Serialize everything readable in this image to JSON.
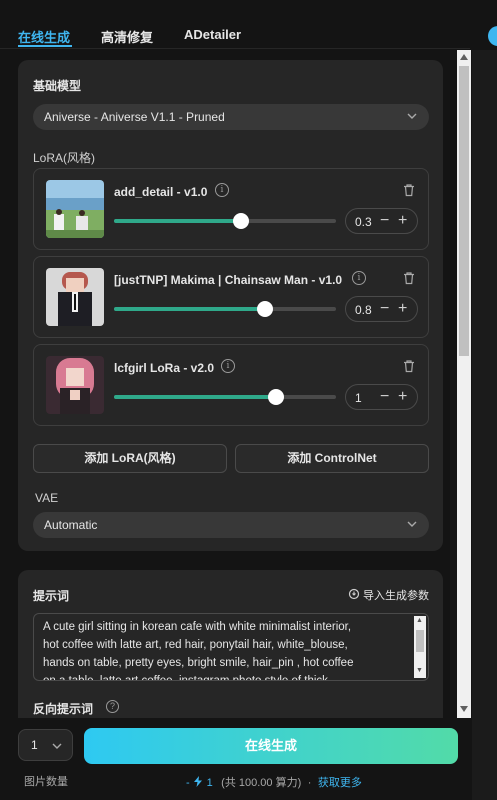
{
  "tabs": [
    "在线生成",
    "高清修复",
    "ADetailer"
  ],
  "base_model": {
    "title": "基础模型",
    "selected": "Aniverse - Aniverse V1.1 - Pruned"
  },
  "lora": {
    "title": "LoRA(风格)",
    "items": [
      {
        "name": "add_detail - v1.0",
        "value": "0.3",
        "slider_fraction": 0.57
      },
      {
        "name": "[justTNP] Makima | Chainsaw Man - v1.0",
        "value": "0.8",
        "slider_fraction": 0.68
      },
      {
        "name": "lcfgirl LoRa - v2.0",
        "value": "1",
        "slider_fraction": 0.73
      }
    ],
    "minus": "−",
    "plus": "+"
  },
  "buttons": {
    "add_lora": "添加 LoRA(风格)",
    "add_controlnet": "添加 ControlNet"
  },
  "vae": {
    "label": "VAE",
    "selected": "Automatic"
  },
  "prompt": {
    "title": "提示词",
    "import_label": "导入生成参数",
    "lines": [
      "A cute girl sitting in korean cafe with white minimalist interior,",
      "hot coffee with latte art, red hair, ponytail hair, white_blouse,",
      "hands on table, pretty eyes, bright smile, hair_pin , hot coffee",
      "on a table, latte art coffee, instagram photo style of thick"
    ]
  },
  "negative_prompt": {
    "title": "反向提示词"
  },
  "footer": {
    "quantity_value": "1",
    "quantity_label": "图片数量",
    "generate_label": "在线生成",
    "cost_prefix": "-",
    "cost_value": "1",
    "cost_detail": "(共 100.00 算力)",
    "dot": "·",
    "more_link": "获取更多"
  },
  "colors": {
    "accent": "#3fb6f0",
    "slider_fill": "#2fa98a",
    "panel_bg": "#262626",
    "page_bg": "#141414"
  }
}
